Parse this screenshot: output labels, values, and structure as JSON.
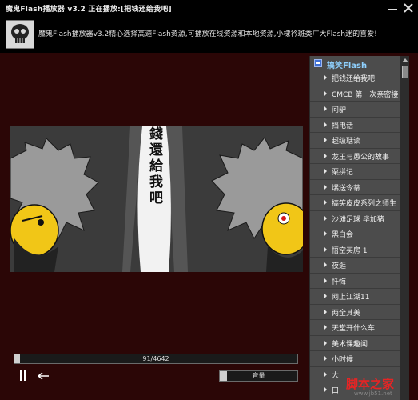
{
  "window": {
    "title": "魔鬼Flash播放器 v3.2    正在播放:[把钱还给我吧]"
  },
  "info": {
    "text": "魔鬼Flash播放器v3.2精心选择高速Flash资源,可播放在线资源和本地资源,小棣衿斑类广大Flash迷的喜爱!"
  },
  "stage": {
    "caption": "把錢還給我吧"
  },
  "sidebar": {
    "category": "搞笑Flash",
    "items": [
      {
        "label": "把钱还给我吧"
      },
      {
        "label": "CMCB 第一次亲密接"
      },
      {
        "label": "问驴"
      },
      {
        "label": "挡电话"
      },
      {
        "label": "超级聒读"
      },
      {
        "label": "龙王与愚公的故事"
      },
      {
        "label": "栗拼记"
      },
      {
        "label": "爆送令蒂"
      },
      {
        "label": "搞笑皮皮系列之师生"
      },
      {
        "label": "沙滩足球 毕加猪"
      },
      {
        "label": "黑白会"
      },
      {
        "label": "悟空买房 1"
      },
      {
        "label": "夜逛"
      },
      {
        "label": "忏悔"
      },
      {
        "label": "网上江湖11"
      },
      {
        "label": "两全其美"
      },
      {
        "label": "天堂开什么车"
      },
      {
        "label": "美术课趣闻"
      },
      {
        "label": "小时候"
      },
      {
        "label": "大"
      },
      {
        "label": "口"
      }
    ]
  },
  "player": {
    "progress_text": "91/4642",
    "progress_fraction": 0.0196,
    "volume_label": "音量",
    "volume_fraction": 0.09
  },
  "watermark": {
    "main": "脚本之家",
    "sub": "www.jb51.net"
  },
  "colors": {
    "frame": "#2b0606",
    "sidebar": "#4c4c4c",
    "category_label": "#8fd1ff",
    "watermark": "#e62424"
  }
}
